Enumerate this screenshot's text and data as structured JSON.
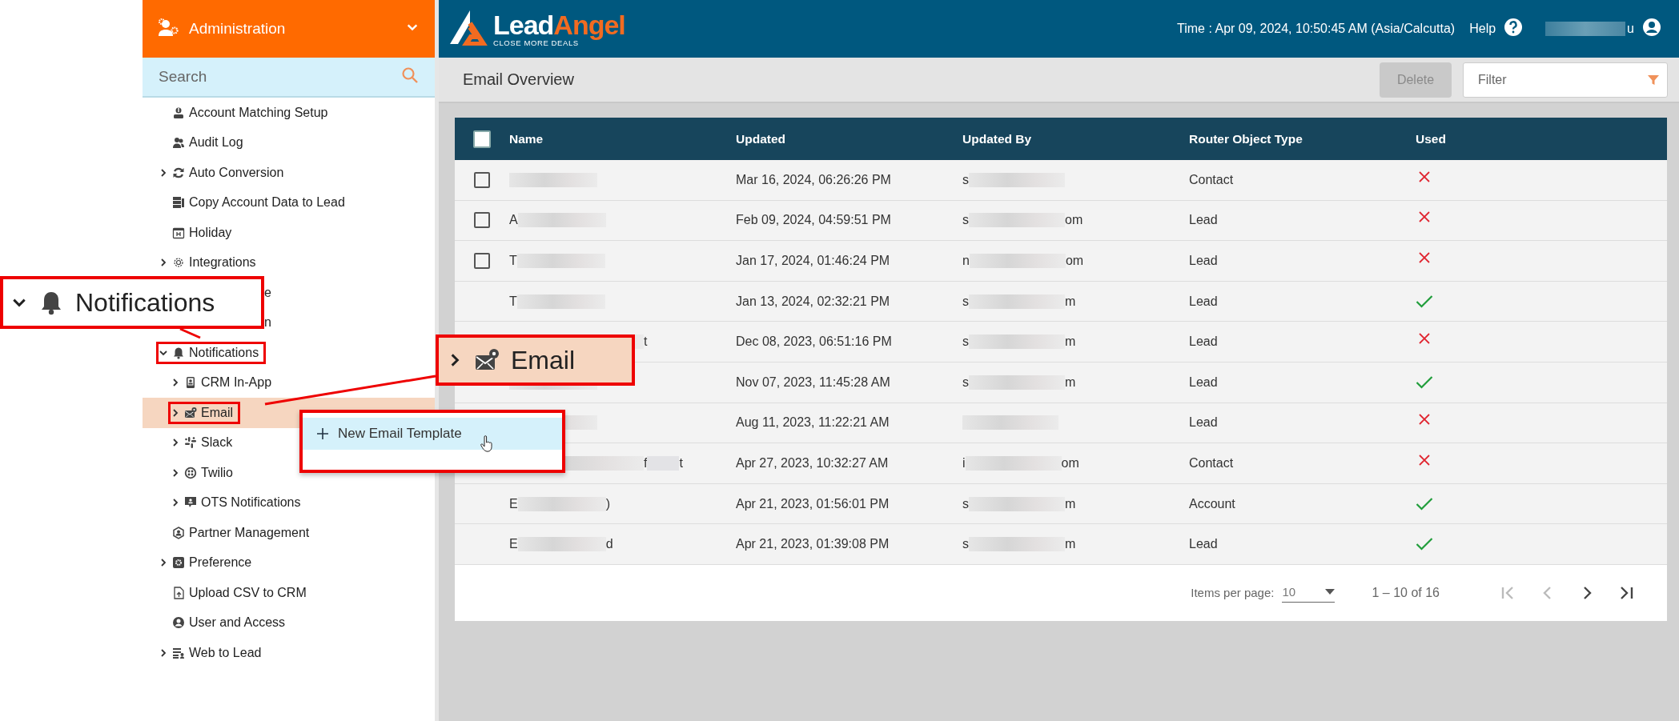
{
  "sidebar": {
    "title": "Administration",
    "search": {
      "placeholder": "Search"
    },
    "items": [
      {
        "label": "Account Matching Setup"
      },
      {
        "label": "Audit Log"
      },
      {
        "label": "Auto Conversion",
        "expanded": false
      },
      {
        "label": "Copy Account Data to Lead"
      },
      {
        "label": "Holiday"
      },
      {
        "label": "Integrations",
        "expanded": false
      },
      {
        "label": "e",
        "kind": "partial"
      },
      {
        "label": "n",
        "kind": "partial"
      },
      {
        "label": "Notifications",
        "expanded": true,
        "annotated": true,
        "children": [
          {
            "label": "CRM In-App",
            "expanded": false
          },
          {
            "label": "Email",
            "expanded": false,
            "selected": true,
            "annotated": true
          },
          {
            "label": "Slack",
            "expanded": false
          },
          {
            "label": "Twilio",
            "expanded": false
          },
          {
            "label": "OTS Notifications",
            "expanded": false
          }
        ]
      },
      {
        "label": "Partner Management"
      },
      {
        "label": "Preference",
        "expanded": false
      },
      {
        "label": "Upload CSV to CRM"
      },
      {
        "label": "User and Access"
      },
      {
        "label": "Web to Lead",
        "expanded": false
      }
    ]
  },
  "header": {
    "logo": {
      "part1": "Lead",
      "part2": "Angel",
      "tagline": "CLOSE MORE DEALS"
    },
    "time": "Time : Apr 09, 2024, 10:50:45 AM (Asia/Calcutta)",
    "help": "Help",
    "user_end": "u"
  },
  "toolbar": {
    "title": "Email Overview",
    "delete": {
      "label": "Delete",
      "disabled": true
    },
    "filter": {
      "placeholder": "Filter"
    }
  },
  "table": {
    "select_all": {
      "checked": false
    },
    "columns": [
      "Name",
      "Updated",
      "Updated By",
      "Router Object Type",
      "Used"
    ],
    "rows": [
      {
        "checked": false,
        "name": {},
        "updated": "Mar 16, 2024, 06:26:26 PM",
        "updated_by": {
          "start": "s"
        },
        "type": "Contact",
        "used": false
      },
      {
        "checked": false,
        "name": {
          "start": "A"
        },
        "updated": "Feb 09, 2024, 04:59:51 PM",
        "updated_by": {
          "start": "s",
          "end": "om"
        },
        "type": "Lead",
        "used": false
      },
      {
        "checked": false,
        "name": {
          "start": "T"
        },
        "updated": "Jan 17, 2024, 01:46:24 PM",
        "updated_by": {
          "start": "n",
          "end": "om"
        },
        "type": "Lead",
        "used": false
      },
      {
        "name": {
          "start": "T"
        },
        "updated": "Jan 13, 2024, 02:32:21 PM",
        "updated_by": {
          "start": "s",
          "end": "m"
        },
        "type": "Lead",
        "used": true
      },
      {
        "name": {
          "end": "t"
        },
        "updated": "Dec 08, 2023, 06:51:16 PM",
        "updated_by": {
          "start": "s",
          "end": "m"
        },
        "type": "Lead",
        "used": false
      },
      {
        "name": {},
        "updated": "Nov 07, 2023, 11:45:28 AM",
        "updated_by": {
          "start": "s",
          "end": "m"
        },
        "type": "Lead",
        "used": true
      },
      {
        "name": {},
        "updated": "Aug 11, 2023, 11:22:21 AM",
        "updated_by": {},
        "type": "Lead",
        "used": false
      },
      {
        "name": {
          "mid": "f",
          "end": "t"
        },
        "updated": "Apr 27, 2023, 10:32:27 AM",
        "updated_by": {
          "start": "i",
          "end": "om"
        },
        "type": "Contact",
        "used": false
      },
      {
        "name": {
          "start": "E",
          "end": ")"
        },
        "updated": "Apr 21, 2023, 01:56:01 PM",
        "updated_by": {
          "start": "s",
          "end": "m"
        },
        "type": "Account",
        "used": true
      },
      {
        "name": {
          "start": "E",
          "end": "d"
        },
        "updated": "Apr 21, 2023, 01:39:08 PM",
        "updated_by": {
          "start": "s",
          "end": "m"
        },
        "type": "Lead",
        "used": true
      }
    ]
  },
  "paginator": {
    "label": "Items per page:",
    "page_size": "10",
    "range": "1 – 10 of 16",
    "first_disabled": true,
    "prev_disabled": true,
    "next_disabled": false,
    "last_disabled": false
  },
  "callouts": [
    {
      "kind": "tree-zoom",
      "label": "Notifications",
      "expanded": true
    },
    {
      "kind": "tree-zoom-selected",
      "label": "Email",
      "expanded": false
    }
  ],
  "context_menu": {
    "items": [
      {
        "label": "New Email Template",
        "selected": true
      }
    ]
  }
}
